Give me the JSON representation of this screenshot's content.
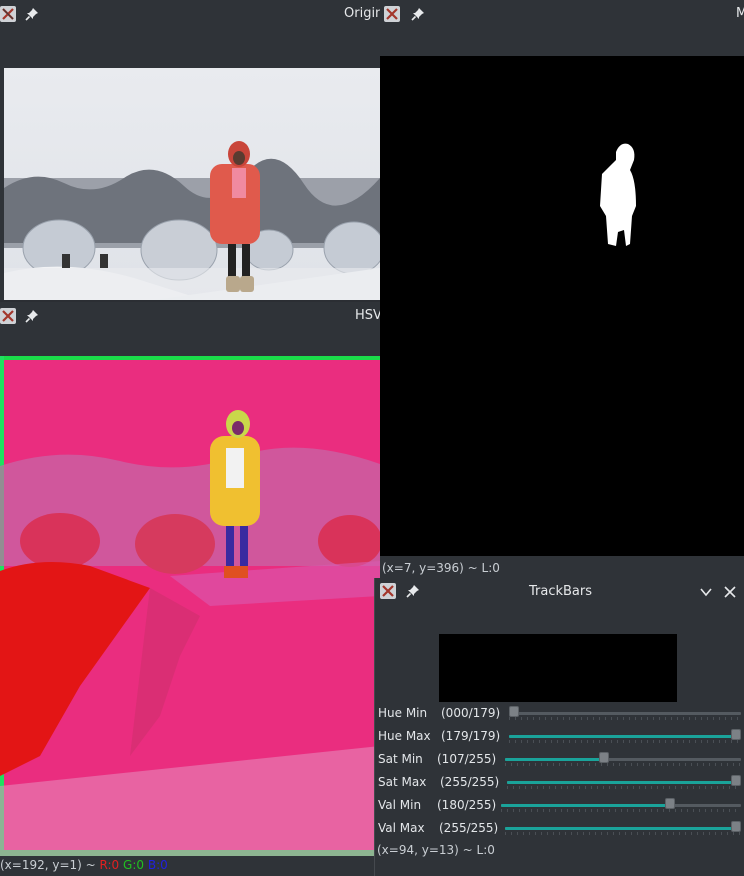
{
  "windows": {
    "original": {
      "title": "Origin"
    },
    "hsv": {
      "title": "HSV",
      "status": "(x=192, y=1) ~",
      "status_r": "R:0",
      "status_g": "G:0",
      "status_b": "B:0"
    },
    "mask": {
      "title": "M",
      "status": "(x=7, y=396) ~ L:0"
    },
    "trackbars": {
      "title": "TrackBars",
      "status": "(x=94, y=13) ~ L:0",
      "sliders": [
        {
          "label": "Hue Min",
          "value_text": "(000/179)",
          "value": 0,
          "max": 179
        },
        {
          "label": "Hue Max",
          "value_text": "(179/179)",
          "value": 179,
          "max": 179
        },
        {
          "label": "Sat Min",
          "value_text": "(107/255)",
          "value": 107,
          "max": 255
        },
        {
          "label": "Sat Max",
          "value_text": "(255/255)",
          "value": 255,
          "max": 255
        },
        {
          "label": "Val Min",
          "value_text": "(180/255)",
          "value": 180,
          "max": 255
        },
        {
          "label": "Val Max",
          "value_text": "(255/255)",
          "value": 255,
          "max": 255
        }
      ]
    }
  },
  "colors": {
    "accent": "#1aa39a",
    "status_r": "#e02020",
    "status_g": "#20c020",
    "status_b": "#2020e0"
  },
  "icons": [
    "app-x-icon",
    "pin-icon",
    "chevron-down-icon",
    "close-icon"
  ]
}
